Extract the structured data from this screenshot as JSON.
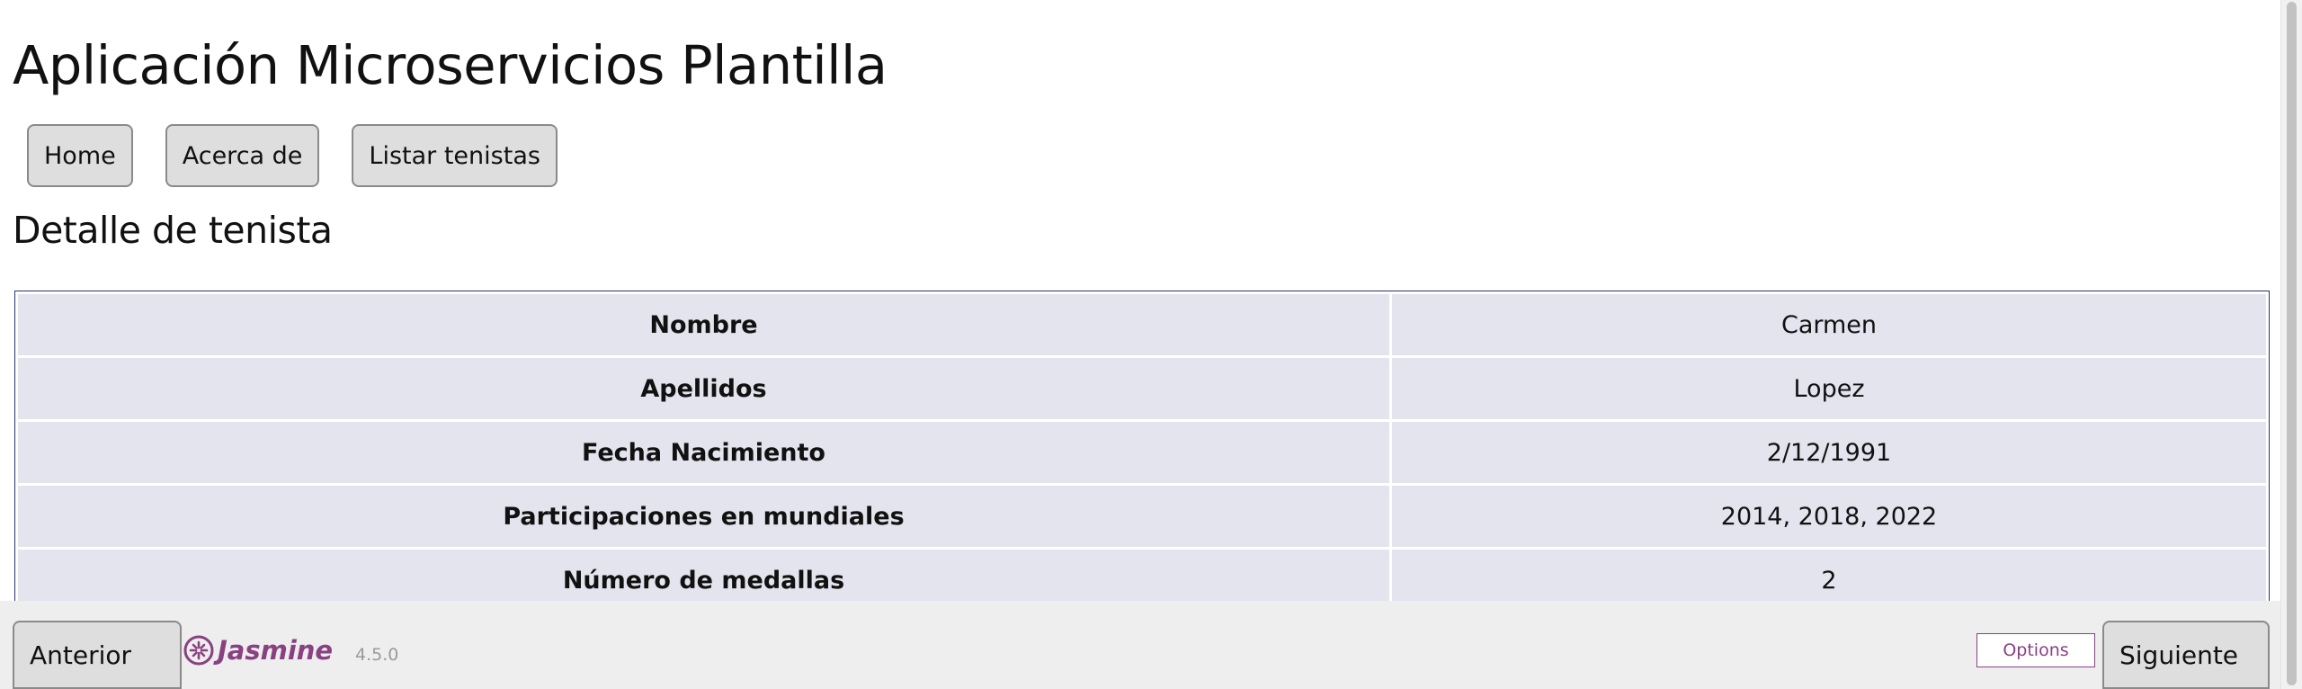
{
  "app": {
    "title": "Aplicación Microservicios Plantilla"
  },
  "nav": {
    "items": [
      {
        "label": "Home"
      },
      {
        "label": "Acerca de"
      },
      {
        "label": "Listar tenistas"
      }
    ]
  },
  "detail": {
    "title": "Detalle de tenista",
    "rows": [
      {
        "label": "Nombre",
        "value": "Carmen"
      },
      {
        "label": "Apellidos",
        "value": "Lopez"
      },
      {
        "label": "Fecha Nacimiento",
        "value": "2/12/1991"
      },
      {
        "label": "Participaciones en mundiales",
        "value": "2014, 2018, 2022"
      },
      {
        "label": "Número de medallas",
        "value": "2"
      }
    ]
  },
  "footer": {
    "prev_label": "Anterior",
    "next_label": "Siguiente",
    "jasmine_brand": "Jasmine",
    "jasmine_version": "4.5.0",
    "options_label": "Options",
    "jasmine_color": "#8a4182",
    "logo_icon": "jasmine-flower-icon"
  }
}
